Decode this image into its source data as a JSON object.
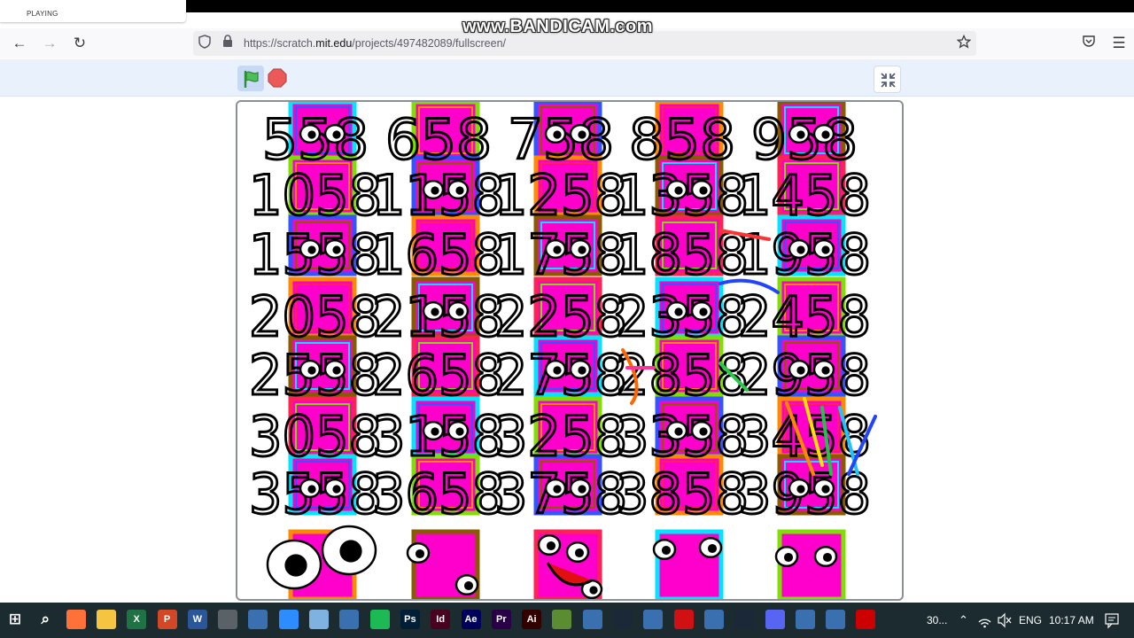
{
  "browser": {
    "tab_label": "PLAYING",
    "url_prefix": "https://scratch.",
    "url_host": "mit.edu",
    "url_path": "/projects/497482089/fullscreen/"
  },
  "watermark": "www.BANDICAM.com",
  "stage": {
    "rows": [
      [
        "558",
        "658",
        "758",
        "858",
        "958"
      ],
      [
        "1058",
        "1158",
        "1258",
        "1358",
        "1458"
      ],
      [
        "1558",
        "1658",
        "1758",
        "1858",
        "1958"
      ],
      [
        "2058",
        "2158",
        "2258",
        "2358",
        "2458"
      ],
      [
        "2558",
        "2658",
        "2758",
        "2858",
        "2958"
      ],
      [
        "3058",
        "3158",
        "3258",
        "3358",
        "3458"
      ],
      [
        "3558",
        "3658",
        "3758",
        "3858",
        "3958"
      ]
    ],
    "block_color": "#ff00cc",
    "border_colors": [
      "#00e5ff",
      "#7fe000",
      "#3355ff",
      "#ff8a00",
      "#8a5a00",
      "#ff2255"
    ]
  },
  "taskbar": {
    "icons": [
      "windows-start",
      "search",
      "firefox",
      "file-explorer",
      "excel",
      "powerpoint",
      "word",
      "calculator",
      "app",
      "zoom",
      "notepad",
      "app",
      "spotify",
      "photoshop",
      "indesign",
      "after-effects",
      "premiere",
      "illustrator",
      "minecraft",
      "app",
      "steam",
      "app",
      "lego",
      "app",
      "steam",
      "discord",
      "app",
      "app",
      "bandicam"
    ],
    "window_label": "30...",
    "language": "ENG",
    "time": "10:17 AM"
  }
}
